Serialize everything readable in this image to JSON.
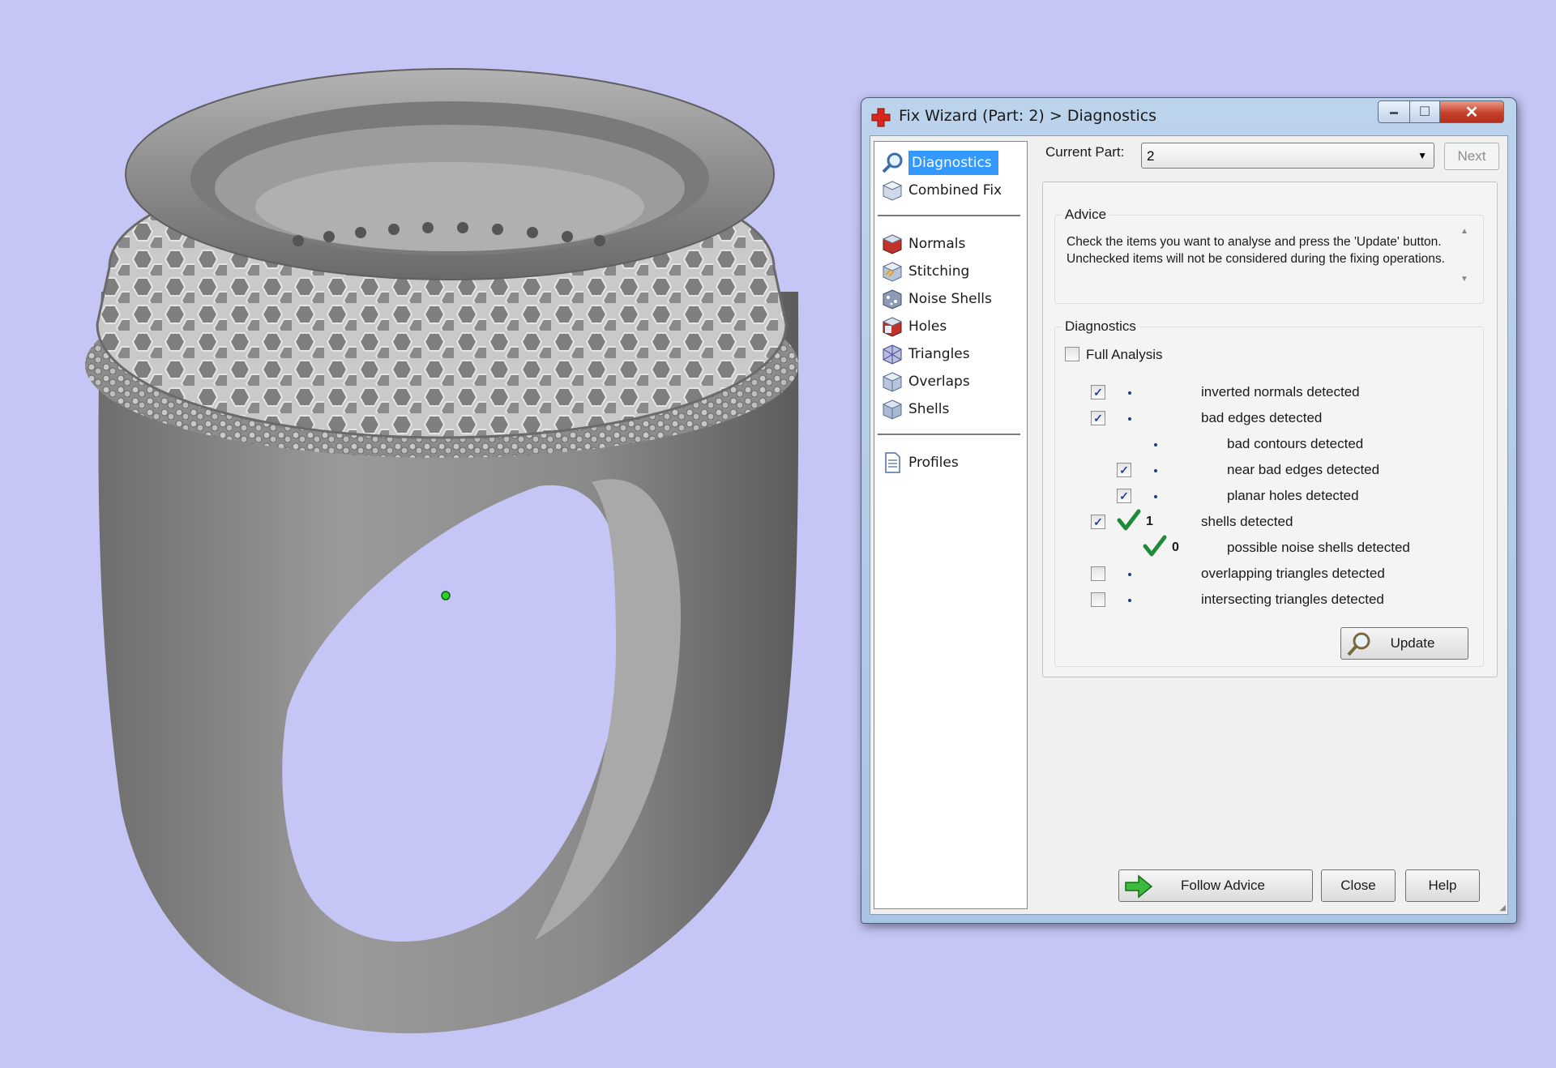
{
  "window": {
    "title": "Fix Wizard (Part: 2) > Diagnostics",
    "close_glyph": "✕",
    "min_glyph": "▬",
    "max_glyph": "☐"
  },
  "nav": {
    "top_items": [
      {
        "label": "Diagnostics",
        "icon": "magnifier-icon",
        "selected": true
      },
      {
        "label": "Combined Fix",
        "icon": "cube-icon"
      }
    ],
    "fix_items": [
      {
        "label": "Normals",
        "icon": "red-cube-icon"
      },
      {
        "label": "Stitching",
        "icon": "stitch-cube-icon"
      },
      {
        "label": "Noise Shells",
        "icon": "noise-cube-icon"
      },
      {
        "label": "Holes",
        "icon": "hole-cube-icon"
      },
      {
        "label": "Triangles",
        "icon": "triangle-cube-icon"
      },
      {
        "label": "Overlaps",
        "icon": "overlap-cube-icon"
      },
      {
        "label": "Shells",
        "icon": "shell-cube-icon"
      }
    ],
    "profiles_label": "Profiles"
  },
  "current_part": {
    "label": "Current Part:",
    "value": "2",
    "next_label": "Next"
  },
  "advice": {
    "title": "Advice",
    "text": "Check the items you want to analyse and press the 'Update' button. Unchecked items will not be considered during the fixing operations."
  },
  "diagnostics": {
    "title": "Diagnostics",
    "full_analysis": {
      "label": "Full Analysis",
      "checked": false
    },
    "rows": [
      {
        "label": "inverted normals detected",
        "checked": true,
        "status": "dot",
        "count": ""
      },
      {
        "label": "bad edges detected",
        "checked": true,
        "status": "dot",
        "count": ""
      },
      {
        "label": "bad contours detected",
        "checked": null,
        "status": "dot",
        "count": ""
      },
      {
        "label": "near bad edges detected",
        "checked": true,
        "status": "dot",
        "count": ""
      },
      {
        "label": "planar holes detected",
        "checked": true,
        "status": "dot",
        "count": ""
      },
      {
        "label": "shells detected",
        "checked": true,
        "status": "ok",
        "count": "1"
      },
      {
        "label": "possible noise shells detected",
        "checked": null,
        "status": "ok",
        "count": "0"
      },
      {
        "label": "overlapping triangles detected",
        "checked": false,
        "status": "dot",
        "count": ""
      },
      {
        "label": "intersecting triangles detected",
        "checked": false,
        "status": "dot",
        "count": ""
      }
    ],
    "update_label": "Update"
  },
  "footer": {
    "follow_advice_label": "Follow Advice",
    "close_label": "Close",
    "help_label": "Help"
  },
  "colors": {
    "viewport_bg": "#c6c6f6",
    "selection": "#3399ff",
    "check_green": "#1f8a3a"
  }
}
